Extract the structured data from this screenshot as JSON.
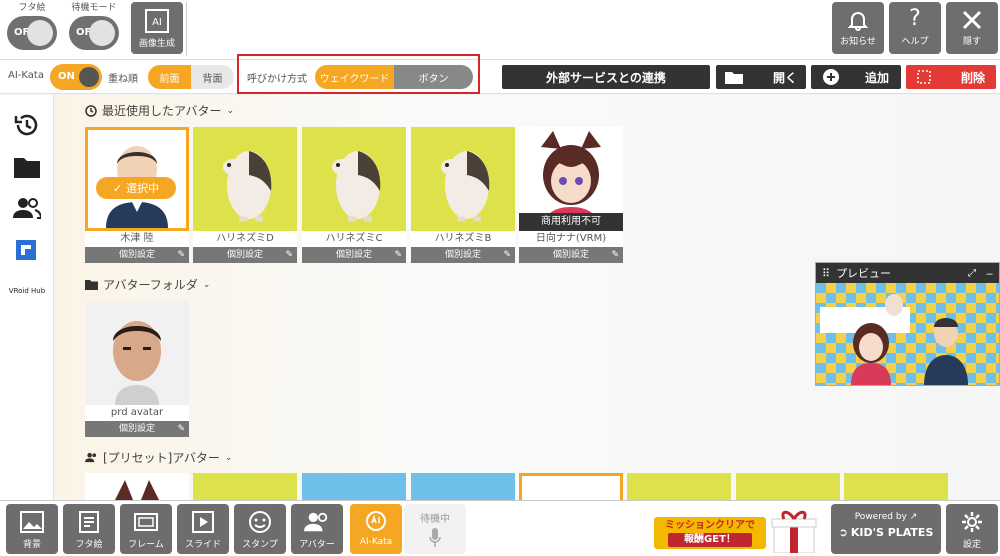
{
  "top": {
    "futae_label": "フタ絵",
    "futae_state": "OFF",
    "standby_label": "待機モード",
    "standby_state": "OFF",
    "image_gen_label": "画像生成",
    "image_gen_ai": "AI",
    "notify_label": "お知らせ",
    "help_label": "ヘルプ",
    "help_glyph": "?",
    "hide_label": "隠す"
  },
  "row2": {
    "aikata_label": "AI-Kata",
    "aikata_state": "ON",
    "order_label": "重ね順",
    "order_front": "前面",
    "order_back": "背面",
    "call_label": "呼びかけ方式",
    "call_wake": "ウェイクワード",
    "call_button": "ボタン",
    "external_label": "外部サービスとの連携",
    "open_label": "開く",
    "add_label": "追加",
    "delete_label": "削除"
  },
  "sidebar": {
    "vroid_label": "VRoid Hub"
  },
  "recent": {
    "title": "最近使用したアバター",
    "selected_badge": "選択中",
    "items": [
      {
        "name": "木津 陸",
        "setting": "個別設定"
      },
      {
        "name": "ハリネズミD",
        "setting": "個別設定"
      },
      {
        "name": "ハリネズミC",
        "setting": "個別設定"
      },
      {
        "name": "ハリネズミB",
        "setting": "個別設定"
      },
      {
        "name": "日向ナナ(VRM)",
        "setting": "個別設定",
        "badge": "商用利用不可"
      }
    ]
  },
  "folder": {
    "title": "アバターフォルダ",
    "items": [
      {
        "name": "prd avatar",
        "setting": "個別設定"
      }
    ]
  },
  "preset": {
    "title": "[プリセット]アバター"
  },
  "preview": {
    "title": "プレビュー"
  },
  "bottom": {
    "items": [
      "背景",
      "フタ絵",
      "フレーム",
      "スライド",
      "スタンプ",
      "アバター",
      "AI-Kata"
    ],
    "standby": "待機中",
    "mission_line1": "ミッションクリアで",
    "mission_line2": "報酬GET！",
    "powered": "Powered by",
    "brand": "KID'S PLATES",
    "settings": "設定"
  },
  "colors": {
    "accent": "#f5a623",
    "danger": "#e53935",
    "highlight_box": "#d9252a",
    "avatar_bg": "#dde24a"
  }
}
